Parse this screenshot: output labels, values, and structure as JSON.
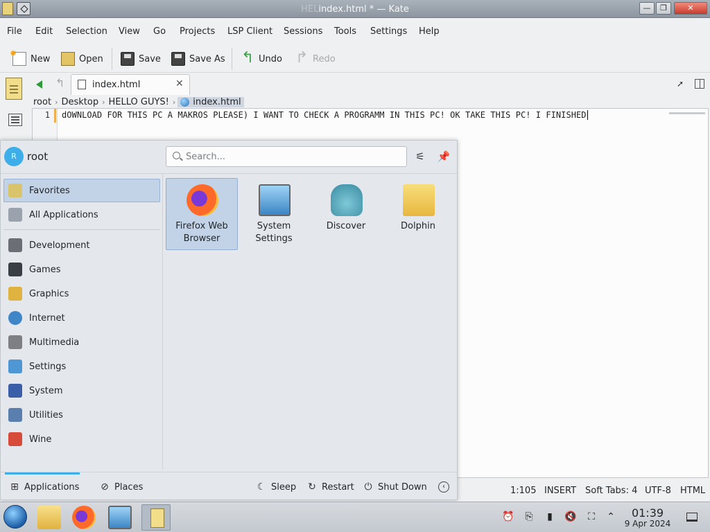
{
  "window": {
    "title": "index.html * — Kate",
    "title_prefix": "HEL"
  },
  "menubar": [
    "File",
    "Edit",
    "Selection",
    "View",
    "Go",
    "Projects",
    "LSP Client",
    "Sessions",
    "Tools",
    "Settings",
    "Help"
  ],
  "toolbar": {
    "new": "New",
    "open": "Open",
    "save": "Save",
    "save_as": "Save As",
    "undo": "Undo",
    "redo": "Redo"
  },
  "tab": {
    "label": "index.html",
    "close": "✕"
  },
  "breadcrumb": [
    "root",
    "Desktop",
    "HELLO GUYS!",
    "index.html"
  ],
  "editor": {
    "line_number": "1",
    "line_text": "dOWNLOAD FOR THIS PC A MAKROS PLEASE) I WANT TO CHECK A PROGRAMM IN THIS PC! OK TAKE THIS PC! I FINISHED"
  },
  "statusbar": {
    "cursor": "1:105",
    "mode": "INSERT",
    "tabs": "Soft Tabs: 4",
    "encoding": "UTF-8",
    "syntax": "HTML"
  },
  "launcher": {
    "avatar_letter": "R",
    "user": "root",
    "search_placeholder": "Search...",
    "categories": [
      {
        "label": "Favorites",
        "icon": "favorites-icon",
        "color": "#d9c46b"
      },
      {
        "label": "All Applications",
        "icon": "all-applications-icon",
        "color": "#9aa3ad"
      },
      {
        "label": "Development",
        "icon": "development-icon",
        "color": "#6b6f75"
      },
      {
        "label": "Games",
        "icon": "games-icon",
        "color": "#3a3f46"
      },
      {
        "label": "Graphics",
        "icon": "graphics-icon",
        "color": "#e0b23f"
      },
      {
        "label": "Internet",
        "icon": "internet-icon",
        "color": "#3f86c8"
      },
      {
        "label": "Multimedia",
        "icon": "multimedia-icon",
        "color": "#7e7f82"
      },
      {
        "label": "Settings",
        "icon": "settings-icon",
        "color": "#4f97d4"
      },
      {
        "label": "System",
        "icon": "system-icon",
        "color": "#3b5ea8"
      },
      {
        "label": "Utilities",
        "icon": "utilities-icon",
        "color": "#5a7fae"
      },
      {
        "label": "Wine",
        "icon": "wine-icon",
        "color": "#d64b3a"
      }
    ],
    "favorites": [
      {
        "label": "Firefox Web Browser"
      },
      {
        "label": "System Settings"
      },
      {
        "label": "Discover"
      },
      {
        "label": "Dolphin"
      }
    ],
    "footer": {
      "applications": "Applications",
      "places": "Places",
      "sleep": "Sleep",
      "restart": "Restart",
      "shutdown": "Shut Down"
    }
  },
  "taskbar": {
    "time": "01:39",
    "date": "9 Apr 2024"
  }
}
